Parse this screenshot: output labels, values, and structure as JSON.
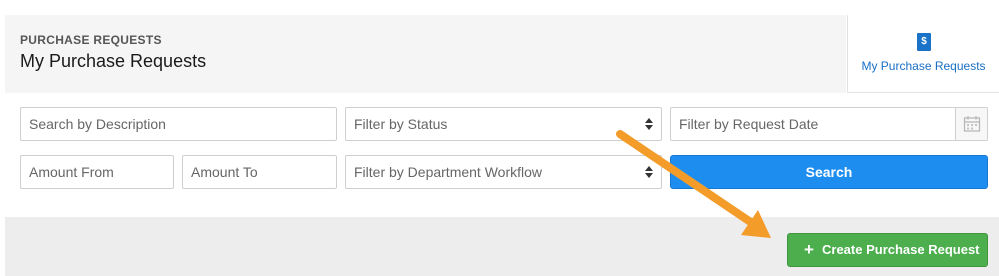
{
  "header": {
    "eyebrow": "PURCHASE REQUESTS",
    "title": "My Purchase Requests"
  },
  "side_link": {
    "label": "My Purchase Requests",
    "icon": "dollar-document-icon",
    "icon_glyph": "$"
  },
  "filters": {
    "search_placeholder": "Search by Description",
    "status_label": "Filter by Status",
    "date_placeholder": "Filter by Request Date",
    "amount_from_placeholder": "Amount From",
    "amount_to_placeholder": "Amount To",
    "workflow_label": "Filter by Department Workflow",
    "search_button": "Search"
  },
  "actions": {
    "create_button": "Create Purchase Request",
    "create_icon": "plus-icon",
    "create_icon_glyph": "+"
  },
  "colors": {
    "accent_blue": "#1d8ef0",
    "create_green": "#4cae4c",
    "annotation_arrow": "#f39c2a",
    "link_blue": "#1a6fc4"
  }
}
